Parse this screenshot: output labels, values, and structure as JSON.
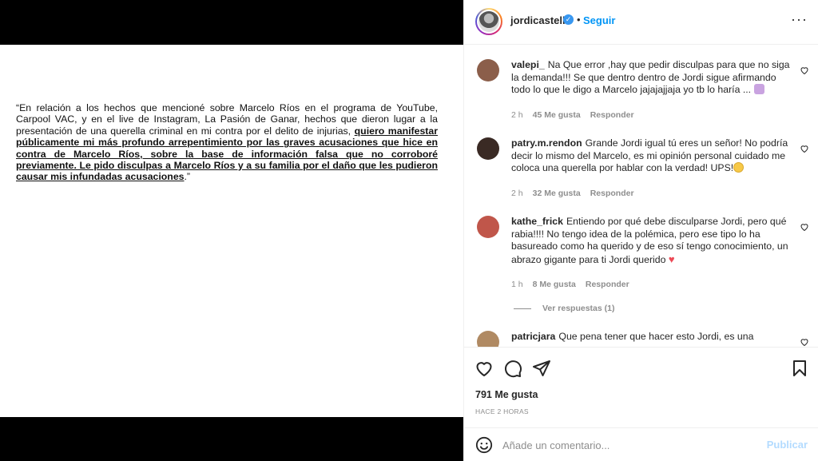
{
  "post": {
    "quote_intro": "“En relación a los hechos que mencioné sobre Marcelo Ríos en el programa de YouTube, Carpool VAC, y en el live de Instagram, La Pasión de Ganar, hechos que dieron lugar a la presentación de una querella criminal en mi contra por el delito de injurias, ",
    "quote_bold": "quiero manifestar públicamente mi más profundo arrepentimiento por las graves acusaciones que hice en contra de Marcelo Ríos, sobre la base de información falsa que no corroboré previamente. Le pido disculpas a Marcelo Ríos y a su familia por el daño que les pudieron causar mis infundadas acusaciones",
    "quote_end": ".”"
  },
  "header": {
    "username": "jordicastell",
    "dot": "•",
    "follow_label": "Seguir",
    "more_label": "···"
  },
  "comments": [
    {
      "user": "valepi_",
      "text": "Na Que error ,hay que pedir disculpas para que no siga la demanda!!! Se que dentro dentro de Jordi sigue afirmando todo lo que le digo a Marcelo jajajajjaja yo tb lo haría ...",
      "time": "2 h",
      "likes": "45 Me gusta",
      "reply": "Responder",
      "avatar_color": "#8b5e4a"
    },
    {
      "user": "patry.m.rendon",
      "text": "Grande Jordi igual tú eres un señor! No podría decir lo mismo del Marcelo, es mi opinión personal cuidado me coloca una querella por hablar con la verdad! UPS!",
      "time": "2 h",
      "likes": "32 Me gusta",
      "reply": "Responder",
      "avatar_color": "#3a2a24"
    },
    {
      "user": "kathe_frick",
      "text": "Entiendo por qué debe disculparse Jordi, pero qué rabia!!!! No tengo idea de la polémica, pero ese tipo lo ha basureado como ha querido y de eso sí tengo conocimiento, un abrazo gigante para ti Jordi querido",
      "time": "1 h",
      "likes": "8 Me gusta",
      "reply": "Responder",
      "avatar_color": "#c0564a",
      "view_replies": "Ver respuestas (1)"
    },
    {
      "user": "patricjara",
      "text": "Que pena tener que hacer esto Jordi, es una",
      "avatar_color": "#b08a63"
    }
  ],
  "actions": {
    "likes": "791 Me gusta",
    "time": "HACE 2 HORAS"
  },
  "add_comment": {
    "placeholder": "Añade un comentario...",
    "publish_label": "Publicar"
  },
  "colors": {
    "accent": "#0095f6",
    "heart": "#ed4956"
  }
}
